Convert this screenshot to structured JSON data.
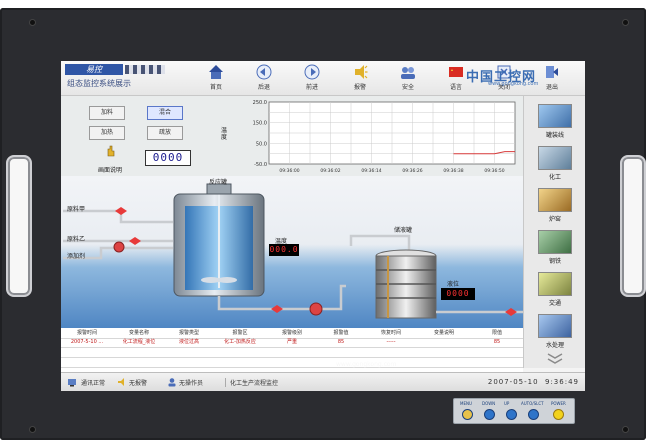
{
  "header": {
    "logo_main": "易控",
    "logo_subtitle": "组态监控系统展示",
    "nav": [
      {
        "label": "首页",
        "icon": "home-icon"
      },
      {
        "label": "后退",
        "icon": "back-arrow-icon"
      },
      {
        "label": "前进",
        "icon": "forward-arrow-icon"
      },
      {
        "label": "报警",
        "icon": "alarm-bell-icon"
      },
      {
        "label": "安全",
        "icon": "security-users-icon"
      },
      {
        "label": "语言",
        "icon": "language-flag-icon"
      },
      {
        "label": "关闭",
        "icon": "close-icon"
      },
      {
        "label": "退出",
        "icon": "exit-icon"
      }
    ]
  },
  "watermark": {
    "text": "中国工控网",
    "url": "www.gongkong.com"
  },
  "controls": {
    "btn_feed": "加料",
    "btn_mix": "混合",
    "btn_heat": "加热",
    "btn_drain": "疏放",
    "help_label": "画面说明",
    "counter": "0000"
  },
  "chart_label": {
    "left": "温度"
  },
  "chart_data": {
    "type": "line",
    "ylabel": "温度",
    "ylim": [
      -50,
      250
    ],
    "yticks": [
      "250.0",
      "150.0",
      "50.0",
      "-50.0"
    ],
    "xticks": [
      "09:36:00",
      "09:36:02",
      "09:36:14",
      "09:36:26",
      "09:36:38",
      "09:36:50"
    ],
    "series": [
      {
        "values": [
          0,
          0,
          0,
          0,
          0,
          10,
          10
        ]
      }
    ],
    "grid": true
  },
  "process": {
    "reactor_label": "反应罐",
    "material_a": "原料甲",
    "material_b": "原料乙",
    "additive": "添加剂",
    "temperature_label": "温度",
    "temperature_value": "000.0",
    "storage_label": "储液罐",
    "level_label": "液位",
    "level_value": "0000"
  },
  "sidebar": [
    {
      "label": "罐装线",
      "color": "#6ca3d8"
    },
    {
      "label": "化工",
      "color": "#7fa0b8"
    },
    {
      "label": "炉窑",
      "color": "#d8b062"
    },
    {
      "label": "钢铁",
      "color": "#6f9a70"
    },
    {
      "label": "交通",
      "color": "#b8c070"
    },
    {
      "label": "水处理",
      "color": "#6590c2"
    }
  ],
  "alarm_table": {
    "columns": [
      "报警时间",
      "变量名称",
      "报警类型",
      "报警区",
      "报警级别",
      "报警值",
      "恢复时间",
      "变量说明",
      "限值"
    ],
    "rows": [
      [
        "2007-5-10 ...",
        "化工流程_液位",
        "液位过高",
        "化工-加热反应",
        "严重",
        "85",
        "-----",
        "",
        "85"
      ]
    ]
  },
  "statusbar": {
    "comm": "通讯正常",
    "alarm": "无报警",
    "operation": "无操作员",
    "screen": "化工生产流程监控",
    "date": "2007-05-10",
    "time": "9:36:49"
  },
  "bottom_watermark": "www.gongkong.com",
  "device_panel": {
    "labels": [
      "MENU",
      "DOWN",
      "UP",
      "AUTO/SLCT",
      "POWER"
    ]
  }
}
